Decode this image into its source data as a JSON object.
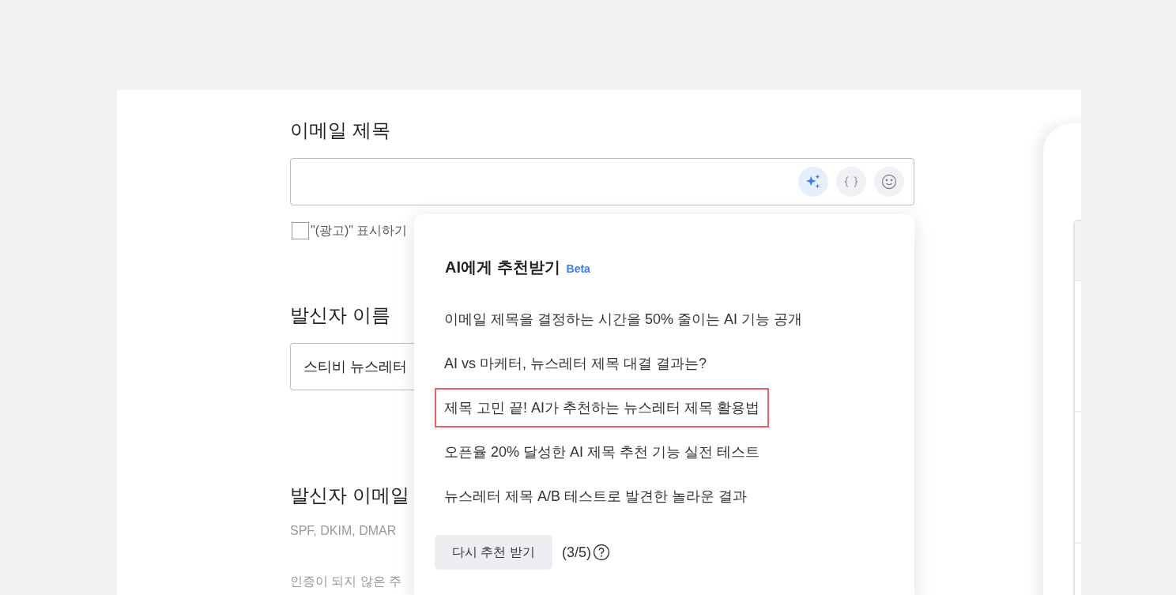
{
  "subject": {
    "label": "이메일 제목",
    "ai_button_active": true,
    "ad_label": {
      "text": "\"(광고)\" 표시하기",
      "checked": false
    }
  },
  "sender_name": {
    "label": "발신자 이름",
    "value": "스티비 뉴스레터"
  },
  "sender_email": {
    "label": "발신자 이메일",
    "help_lines": [
      "SPF, DKIM, DMAR",
      "인증이 되지 않은 주"
    ]
  },
  "ai_popup": {
    "title": "AI에게 추천받기",
    "badge": "Beta",
    "suggestions": [
      {
        "text": "이메일 제목을 결정하는 시간을 50% 줄이는 AI 기능 공개",
        "selected": false
      },
      {
        "text": "AI vs 마케터, 뉴스레터 제목 대결 결과는?",
        "selected": false
      },
      {
        "text": "제목 고민 끝! AI가 추천하는 뉴스레터 제목 활용법",
        "selected": true
      },
      {
        "text": "오픈율 20% 달성한 AI 제목 추천 기능 실전 테스트",
        "selected": false
      },
      {
        "text": "뉴스레터 제목 A/B 테스트로 발견한 놀라운 결과",
        "selected": false
      }
    ],
    "retry_button": "다시 추천 받기",
    "count": "(3/5)"
  }
}
